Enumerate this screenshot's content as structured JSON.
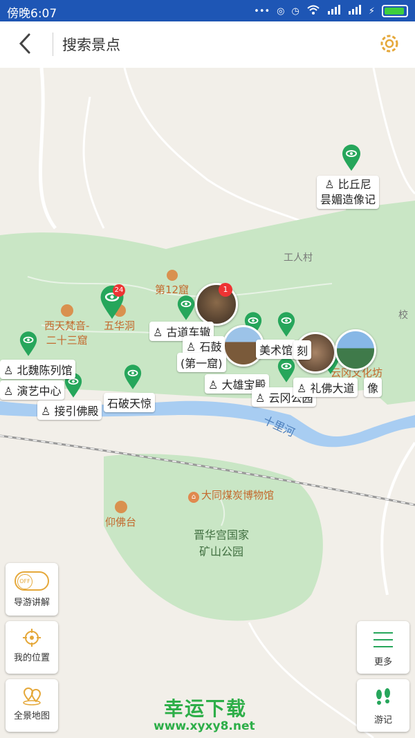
{
  "status_bar": {
    "time": "傍晚6:07"
  },
  "header": {
    "search_placeholder": "搜索景点"
  },
  "map": {
    "area_labels": {
      "gongren_cun": "工人村",
      "xiao": "校",
      "shili_he": "十里河",
      "park_line1": "晋华宫国家",
      "park_line2": "矿山公园"
    },
    "pois": {
      "coal_museum": "大同煤炭博物馆",
      "yangfotai": "仰佛台",
      "cave12": "第12窟",
      "xitian_line1": "西天梵音-",
      "xitian_line2": "二十三窟",
      "wuhuadong": "五华洞",
      "yungang_culture": "云冈文化坊"
    },
    "spot_labels": {
      "biqiuni_line1": "比丘尼",
      "biqiuni_line2": "昙媚造像记",
      "gudao": "古道车辙",
      "shigu": "石鼓",
      "diyiku": "(第一窟)",
      "meishuguan": "美术馆",
      "ke": "刻",
      "beiwei": "北魏陈列馆",
      "yanyi": "演艺中心",
      "jieyin": "接引佛殿",
      "shipo": "石破天惊",
      "daxiong": "大雄宝殿",
      "lifo": "礼佛大道",
      "yungang_park": "云冈公园",
      "xiang": "像"
    },
    "cluster_badges": {
      "big_pin": "24",
      "photo_pin": "1"
    }
  },
  "controls": {
    "guide": {
      "label": "导游讲解",
      "toggle": "OFF"
    },
    "location": {
      "label": "我的位置"
    },
    "overview": {
      "label": "全景地图"
    },
    "more": {
      "label": "更多"
    },
    "travel_log": {
      "label": "游记"
    }
  },
  "watermark": {
    "title": "幸运下载",
    "url": "www.xyxy8.net"
  },
  "colors": {
    "status_bar": "#1e56b5",
    "pin": "#26a65b",
    "accent": "#e5a83a",
    "park": "#c9e6c5",
    "river": "#a8cdf2"
  }
}
